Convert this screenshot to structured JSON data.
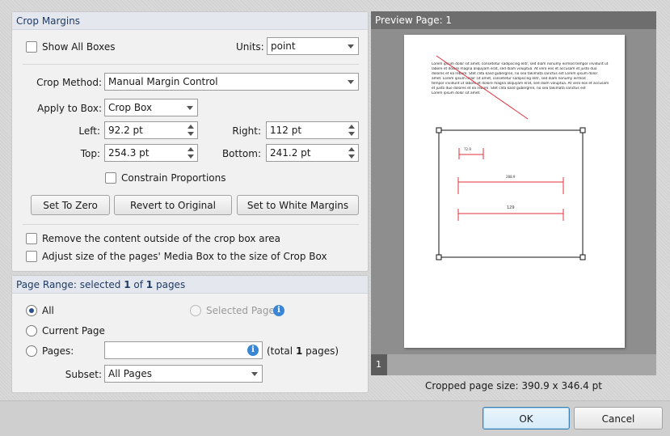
{
  "crop_margins": {
    "title": "Crop Margins",
    "show_all_boxes": "Show All Boxes",
    "units_label": "Units:",
    "units_value": "point",
    "crop_method_label": "Crop Method:",
    "crop_method_value": "Manual Margin Control",
    "apply_to_box_label": "Apply to Box:",
    "apply_to_box_value": "Crop Box",
    "left_label": "Left:",
    "left_value": "92.2 pt",
    "right_label": "Right:",
    "right_value": "112 pt",
    "top_label": "Top:",
    "top_value": "254.3 pt",
    "bottom_label": "Bottom:",
    "bottom_value": "241.2 pt",
    "constrain_proportions": "Constrain Proportions",
    "set_to_zero": "Set To Zero",
    "revert_to_original": "Revert to Original",
    "set_to_white_margins": "Set to White Margins",
    "remove_content": "Remove the content outside of the crop box area",
    "adjust_media_box": "Adjust size of the pages' Media Box to the size of Crop Box"
  },
  "page_range": {
    "title_prefix": "Page Range: selected ",
    "selected": "1",
    "title_mid": " of ",
    "total": "1",
    "title_suffix": " pages",
    "all": "All",
    "selected_pages": "Selected Pages",
    "current_page": "Current Page",
    "pages_label": "Pages:",
    "pages_value": "",
    "total_prefix": "(total ",
    "total_count": "1",
    "total_suffix": " pages)",
    "subset_label": "Subset:",
    "subset_value": "All Pages"
  },
  "preview": {
    "title": "Preview Page: 1",
    "page_tab": "1",
    "cropped_size": "Cropped page size: 390.9 x 346.4 pt",
    "lorem_lines": [
      "Lorem ipsum dolor sit amet, consetetur sadipscing elitr, sed diam nonumy eirmod tempor invidunt ut",
      "labore et dolore magna aliquyam erat, sed diam voluptua. At vero eos et accusam et justo duo",
      "dolores et ea rebum. Stet clita kasd gubergren, no sea takimata sanctus est Lorem ipsum dolor",
      "amet. Lorem ipsum dolor sit amet, consetetur sadipscing elitr, sed diam nonumy eirmod",
      "tempor invidunt ut labore et dolore magna aliquyam erat, sed diam voluptua. At vero eos et accusam",
      "et justo duo dolores et ea rebum. Stet clita kasd gubergren, no sea takimata sanctus est",
      "Lorem ipsum dolor sit amet."
    ],
    "dim1": "72.9",
    "dim2": "288.9",
    "dim3": "129"
  },
  "footer": {
    "ok": "OK",
    "cancel": "Cancel"
  },
  "colors": {
    "accent": "#2b4f86",
    "annotation_red": "#e0303a"
  }
}
